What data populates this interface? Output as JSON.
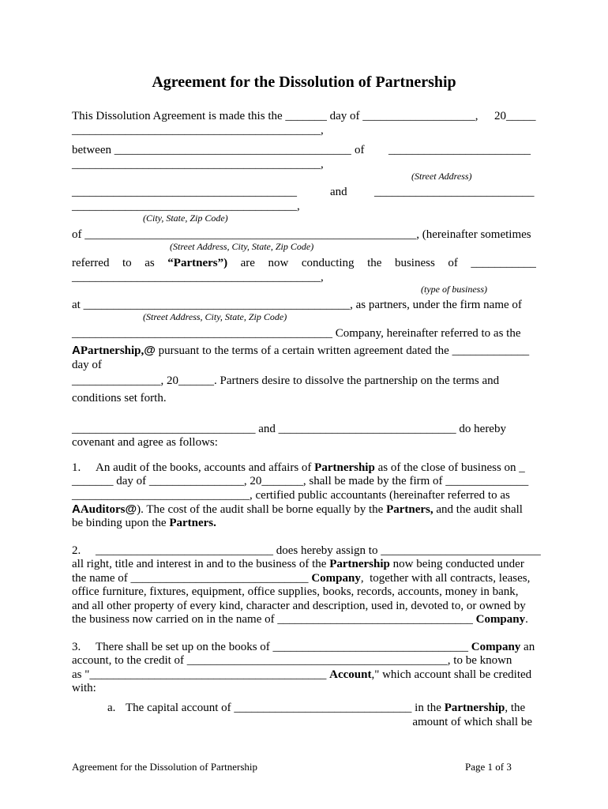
{
  "document": {
    "title": "Agreement for the Dissolution of Partnership",
    "intro": {
      "line1_a": "This Dissolution Agreement is made this the _______ day of ___________________,",
      "line1_b": "20_____",
      "line2": "__________________________________________,",
      "line3_a": "between ________________________________________",
      "line3_of": "of",
      "line3_b": "________________________",
      "line4": "__________________________________________,",
      "cap_street": "(Street Address)",
      "line5_a": "______________________________________",
      "line5_and": "and",
      "line5_b": "___________________________",
      "line6": "______________________________________,",
      "cap_city": "(City, State, Zip Code)",
      "line7": "of ________________________________________________________, (hereinafter sometimes",
      "cap_full_address_1": "(Street Address, City, State, Zip Code)",
      "line8_words": [
        "referred",
        "to",
        "as",
        "“Partners”)",
        "are",
        "now",
        "conducting",
        "the",
        "business",
        "of",
        "___________"
      ],
      "line9": "__________________________________________,",
      "cap_business": "(type of business)",
      "line10": "at _____________________________________________, as partners, under the firm name of",
      "cap_full_address_2": "(Street Address, City, State, Zip Code)",
      "line11": "____________________________________________ Company, hereinafter referred to as the",
      "line12_a": "A",
      "line12_b": "Partnership,",
      "line12_c": "@",
      "line12_d": " pursuant to the terms of a certain written agreement dated the _____________",
      "line13": "day of",
      "line14": "_______________, 20______. Partners desire to dissolve the partnership on the terms and",
      "line15": "conditions set forth.",
      "line16": "_______________________________ and ______________________________ do hereby",
      "line17": "covenant and agree as follows:"
    },
    "clauses": [
      {
        "number": "1.",
        "lines": [
          [
            "An audit of the books, accounts and affairs of ",
            {
              "b": "Partnership"
            },
            " as of the close of business on _"
          ],
          [
            "_______ day of ________________, 20_______, shall be made by the firm of ______________"
          ],
          [
            "______________________________, certified public accountants (hereinafter referred to as"
          ],
          [
            {
              "sb": "A"
            },
            {
              "b": "Auditors"
            },
            {
              "sb": "@"
            },
            "). The cost of the audit shall be borne equally by the ",
            {
              "b": "Partners,"
            },
            " and the audit shall"
          ],
          [
            "be binding upon the ",
            {
              "b": "Partners."
            }
          ]
        ]
      },
      {
        "number": "2.",
        "lines": [
          [
            "______________________________ does hereby assign to ___________________________"
          ],
          [
            "all right, title and interest in and to the business of the ",
            {
              "b": "Partnership"
            },
            " now being conducted under"
          ],
          [
            "the name of ______________________________ ",
            {
              "b": "Company"
            },
            ",  together with all contracts, leases,"
          ],
          [
            "office furniture, fixtures, equipment, office supplies, books, records, accounts, money in bank,"
          ],
          [
            "and all other property of every kind, character and description, used in, devoted to, or owned by"
          ],
          [
            "the business now carried on in the name of _________________________________ ",
            {
              "b": "Company"
            },
            "."
          ]
        ]
      },
      {
        "number": "3.",
        "lines": [
          [
            "There shall be set up on the books of _________________________________ ",
            {
              "b": "Company"
            },
            " an"
          ],
          [
            "account, to the credit of ____________________________________________, to be known"
          ],
          [
            "as \"________________________________________ ",
            {
              "b": "Account"
            },
            ",\" which account shall be credited"
          ],
          [
            "with:"
          ]
        ],
        "sub": {
          "letter": "a.",
          "line1": [
            "The capital account of ______________________________ in the ",
            {
              "b": "Partnership"
            },
            ", the"
          ],
          "line2": "amount of which shall be"
        }
      }
    ],
    "footer": {
      "left": "Agreement for the Dissolution of Partnership",
      "right": "Page 1 of 3"
    }
  }
}
